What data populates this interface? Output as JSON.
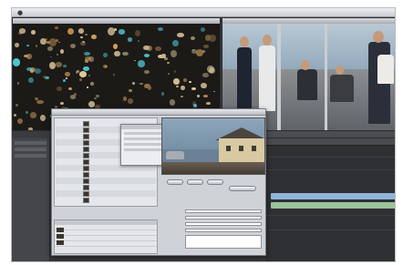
{
  "menubar": {
    "apple_icon": "apple-icon",
    "items": [],
    "clock": ""
  },
  "viewers": {
    "left_title": "",
    "right_title": ""
  },
  "dialog": {
    "title": "",
    "pref_panel_title": ""
  },
  "colors": {
    "background": "#3a3b3e",
    "timeline_track_blue": "#8fb6d8",
    "timeline_track_green": "#9cc39a",
    "dialog_bg": "#cfd2d7",
    "bokeh_cyan": "#4fc6d6",
    "bokeh_amber": "#d6a05c"
  }
}
